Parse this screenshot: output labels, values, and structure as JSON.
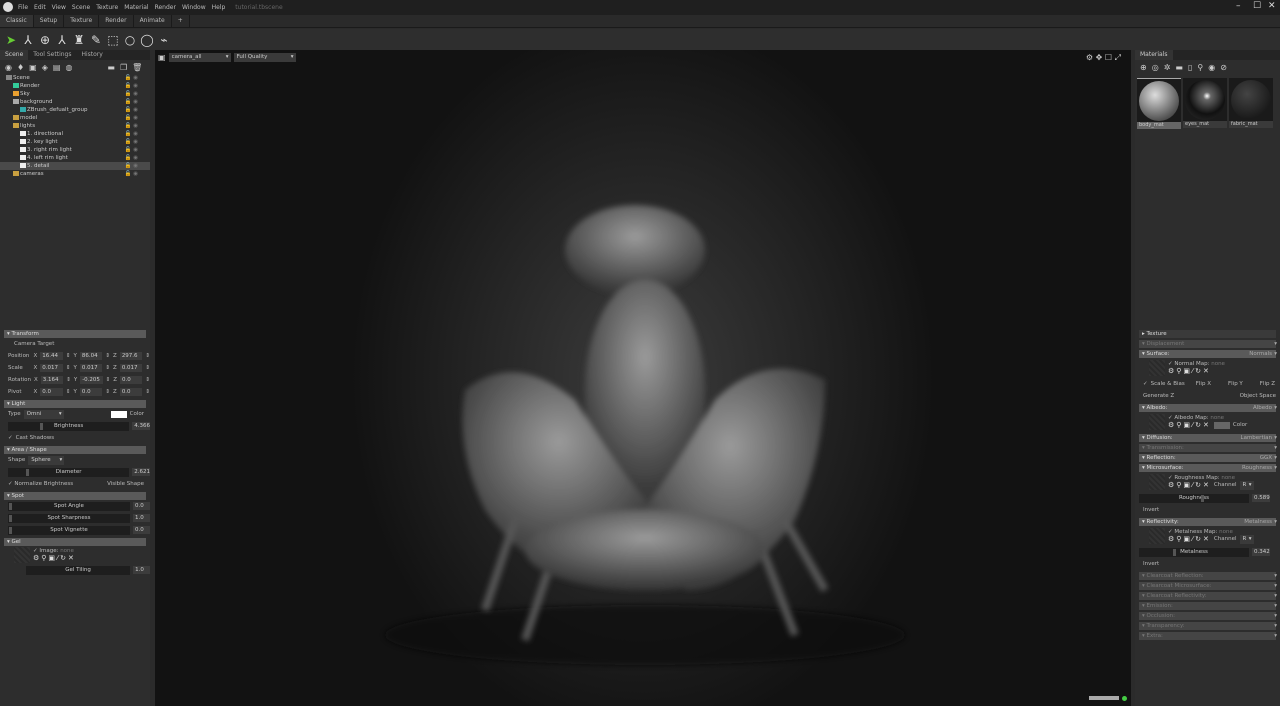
{
  "window": {
    "menu": [
      "File",
      "Edit",
      "View",
      "Scene",
      "Texture",
      "Material",
      "Render",
      "Window",
      "Help"
    ],
    "title": "tutorial.tbscene"
  },
  "tabs": [
    "Classic",
    "Setup",
    "Texture",
    "Render",
    "Animate",
    "+"
  ],
  "left_tabs": [
    "Scene",
    "Tool Settings",
    "History"
  ],
  "tree": [
    {
      "label": "Scene",
      "depth": 0,
      "color": "#888"
    },
    {
      "label": "Render",
      "depth": 1,
      "color": "#3c9"
    },
    {
      "label": "Sky",
      "depth": 1,
      "color": "#e9a030"
    },
    {
      "label": "background",
      "depth": 1,
      "color": "#aaa"
    },
    {
      "label": "ZBrush_defualt_group",
      "depth": 2,
      "color": "#3aa"
    },
    {
      "label": "model",
      "depth": 1,
      "color": "#c9a040"
    },
    {
      "label": "lights",
      "depth": 1,
      "color": "#c9a040"
    },
    {
      "label": "1. directional",
      "depth": 2,
      "color": "#eee"
    },
    {
      "label": "2. key light",
      "depth": 2,
      "color": "#eee"
    },
    {
      "label": "3. right rim light",
      "depth": 2,
      "color": "#eee"
    },
    {
      "label": "4. left rim light",
      "depth": 2,
      "color": "#eee"
    },
    {
      "label": "5. detail",
      "depth": 2,
      "color": "#eee",
      "selected": true
    },
    {
      "label": "cameras",
      "depth": 1,
      "color": "#c9a040"
    }
  ],
  "viewport": {
    "camera": "camera_all",
    "quality": "Full Quality"
  },
  "transform": {
    "title": "Transform",
    "camera_target": "Camera Target",
    "rows": [
      {
        "label": "Position",
        "x": "16.44",
        "y": "86.04",
        "z": "297.6"
      },
      {
        "label": "Scale",
        "x": "0.017",
        "y": "0.017",
        "z": "0.017"
      },
      {
        "label": "Rotation",
        "x": "3.164",
        "y": "-0.205",
        "z": "0.0"
      },
      {
        "label": "Pivot",
        "x": "0.0",
        "y": "0.0",
        "z": "0.0"
      }
    ]
  },
  "light": {
    "title": "Light",
    "type_label": "Type",
    "type": "Omni",
    "color_label": "Color",
    "brightness_label": "Brightness",
    "brightness": "4.366",
    "cast_shadows": "Cast Shadows"
  },
  "area": {
    "title": "Area / Shape",
    "shape_label": "Shape",
    "shape": "Sphere",
    "diameter_label": "Diameter",
    "diameter": "2.621",
    "normalize": "Normalize Brightness",
    "visible": "Visible Shape"
  },
  "spot": {
    "title": "Spot",
    "rows": [
      {
        "label": "Spot Angle",
        "value": "0.0"
      },
      {
        "label": "Spot Sharpness",
        "value": "1.0"
      },
      {
        "label": "Spot Vignette",
        "value": "0.0"
      }
    ]
  },
  "gel": {
    "title": "Gel",
    "image": "Image:",
    "image_value": "none",
    "tiling_label": "Gel Tiling",
    "tiling": "1.0"
  },
  "materials": {
    "title": "Materials",
    "items": [
      "body_mat",
      "eyes_mat",
      "fabric_mat"
    ]
  },
  "props": {
    "texture": "Texture",
    "displacement": "Displacement",
    "surface": "Surface:",
    "surface_mode": "Normals",
    "normal_map": "Normal Map:",
    "none": "none",
    "scale_bias": "Scale & Bias",
    "flipx": "Flip X",
    "flipy": "Flip Y",
    "flipz": "Flip Z",
    "genz": "Generate Z",
    "objspace": "Object Space",
    "albedo": "Albedo:",
    "albedo_mode": "Albedo",
    "albedo_map": "Albedo Map:",
    "color": "Color",
    "diffusion": "Diffusion:",
    "diffusion_mode": "Lambertian",
    "transmission": "Transmission:",
    "reflection": "Reflection:",
    "reflection_mode": "GGX",
    "micro": "Microsurface:",
    "micro_mode": "Roughness",
    "rough_map": "Roughness Map:",
    "channel": "Channel",
    "channel_val": "R",
    "roughness": "Roughness",
    "roughness_val": "0.589",
    "invert": "Invert",
    "refl": "Reflectivity:",
    "refl_mode": "Metalness",
    "metal_map": "Metalness Map:",
    "metalness": "Metalness",
    "metalness_val": "0.342",
    "extra": [
      "Clearcoat Reflection:",
      "Clearcoat Microsurface:",
      "Clearcoat Reflectivity:",
      "Emission:",
      "Occlusion:",
      "Transparency:",
      "Extra:"
    ]
  }
}
